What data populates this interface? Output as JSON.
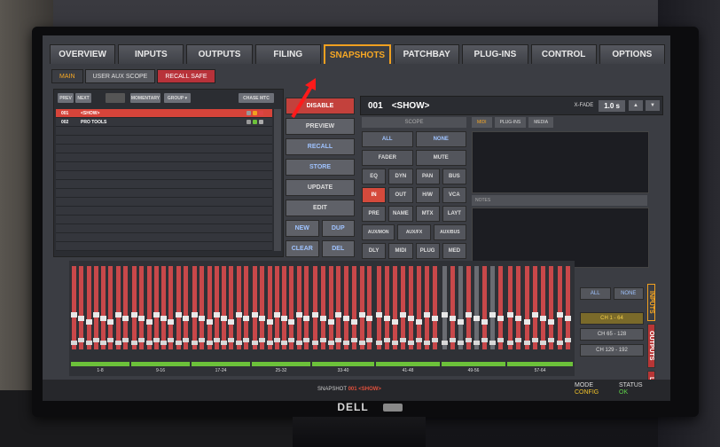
{
  "main_tabs": [
    "OVERVIEW",
    "INPUTS",
    "OUTPUTS",
    "FILING",
    "SNAPSHOTS",
    "PATCHBAY",
    "PLUG-INS",
    "CONTROL",
    "OPTIONS"
  ],
  "sub_tabs": [
    "MAIN",
    "USER AUX SCOPE",
    "RECALL SAFE"
  ],
  "list_buttons": [
    "PREV",
    "NEXT",
    "",
    "MOMENTARY",
    "GROUP ▾",
    "CHASE MTC"
  ],
  "snapshots": [
    {
      "num": "001",
      "name": "<SHOW>"
    },
    {
      "num": "002",
      "name": "PRO TOOLS"
    }
  ],
  "mid_buttons": {
    "disable": "DISABLE",
    "preview": "PREVIEW",
    "recall": "RECALL",
    "store": "STORE",
    "update": "UPDATE",
    "edit": "EDIT",
    "new": "NEW",
    "dup": "DUP",
    "clear": "CLEAR",
    "del": "DEL"
  },
  "header": {
    "num": "001",
    "name": "<SHOW>",
    "xfade_label": "X-FADE",
    "xfade_value": "1.0 s"
  },
  "scope": {
    "title": "SCOPE",
    "all": "ALL",
    "none": "NONE",
    "fader": "FADER",
    "mute": "MUTE",
    "grid": [
      "EQ",
      "DYN",
      "PAN",
      "BUS",
      "IN",
      "OUT",
      "H/W",
      "VCA",
      "PRE",
      "NAME",
      "MTX",
      "LAYT",
      "AUX/MON",
      "AUX/FX",
      "AUX/BUS",
      "DLY",
      "MIDI",
      "PLUG",
      "MED"
    ]
  },
  "midi_tabs": [
    "MIDI",
    "PLUG-INS",
    "MEDIA"
  ],
  "notes_label": "NOTES",
  "mixer_groups": [
    "1-8",
    "9-16",
    "17-24",
    "25-32",
    "33-40",
    "41-48",
    "49-56",
    "57-64"
  ],
  "right_side": {
    "all": "ALL",
    "none": "NONE",
    "ranges": [
      "CH 1 - 64",
      "CH 65 - 128",
      "CH 129 - 192"
    ]
  },
  "vertical_tabs": [
    "INPUTS",
    "OUTPUTS",
    "LAYOUTS"
  ],
  "status_bar": {
    "snapshot_label": "SNAPSHOT",
    "snapshot_value": "001 <SHOW>",
    "mode_label": "MODE",
    "mode_value": "CONFIG",
    "status_label": "STATUS",
    "status_value": "OK"
  },
  "brand": "DELL",
  "colors": {
    "accent": "#f0a020",
    "red": "#c3413c",
    "green": "#6cc13a",
    "blue_text": "#9fc3ff"
  }
}
